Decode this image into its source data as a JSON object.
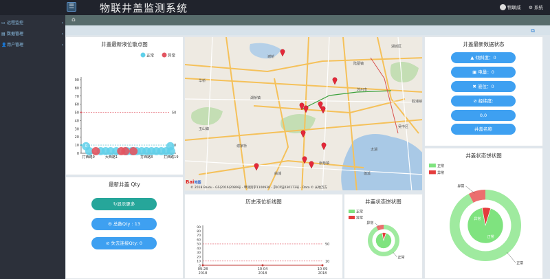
{
  "header": {
    "menu_icon": "menu-icon",
    "title": "物联井盖监测系统",
    "user_name": "物联威",
    "system_label": "系统"
  },
  "sidebar": {
    "items": [
      {
        "label": "远程监控",
        "icon": "monitor-icon"
      },
      {
        "label": "数据管理",
        "icon": "data-icon"
      },
      {
        "label": "用户管理",
        "icon": "user-icon"
      }
    ]
  },
  "scatter": {
    "title": "井盖最新液位散点图",
    "legend": [
      "正常",
      "异常"
    ],
    "colors": {
      "normal": "#5fd0ea",
      "abnormal": "#e25561",
      "markline": "#e25561",
      "markline2": "#3fb6c6"
    },
    "chart_data": {
      "type": "scatter",
      "ylim": [
        0,
        90
      ],
      "yticks": [
        0,
        10,
        20,
        30,
        40,
        50,
        60,
        70,
        80,
        90
      ],
      "xticks": [
        "打西路9",
        "大西路1",
        "打西路8",
        "打西路19"
      ],
      "marklines": [
        {
          "value": 50,
          "label": "50"
        },
        {
          "value": 10,
          "label": "10"
        }
      ],
      "normal": [
        {
          "x": 1,
          "y": 0
        },
        {
          "x": 2.4,
          "y": 0
        },
        {
          "x": 3.0,
          "y": 0
        },
        {
          "x": 3.6,
          "y": 0
        },
        {
          "x": 4.3,
          "y": 0
        },
        {
          "x": 5.6,
          "y": 0
        },
        {
          "x": 6.2,
          "y": 0
        },
        {
          "x": 6.8,
          "y": 0
        },
        {
          "x": 7.4,
          "y": 0
        },
        {
          "x": 8.0,
          "y": 0
        },
        {
          "x": 8.6,
          "y": 0
        },
        {
          "x": 9.2,
          "y": 0
        },
        {
          "x": 9.8,
          "y": 0
        },
        {
          "x": 10.4,
          "y": 0
        },
        {
          "x": 11.0,
          "y": 0
        },
        {
          "x": 0.6,
          "y": 1
        },
        {
          "x": 10.9,
          "y": 1
        }
      ],
      "abnormal": [
        {
          "x": 1.8,
          "y": 0
        },
        {
          "x": 4.9,
          "y": 0
        },
        {
          "x": 5.4,
          "y": 0
        },
        {
          "x": 6.4,
          "y": 0
        }
      ],
      "labels": [
        "0",
        "0"
      ]
    }
  },
  "map": {
    "copyright": "© 2018 Baidu - GS(2016)2089号 - 甲测资字1100930 - 京ICP证030173号 - Data © 长地万方",
    "logo": "Bai",
    "logo_suffix": "地图",
    "labels": [
      "谢桥",
      "华桥",
      "湖桥镇",
      "玉山镇",
      "谢家桥",
      "苏州市",
      "陆墓镇",
      "湖城区",
      "吴中区",
      "张巷镇",
      "曲浦",
      "莲溪",
      "胜浦镇",
      "太湖"
    ],
    "markers": 11
  },
  "status": {
    "title": "井盖最新数据状态",
    "items": [
      "倾斜度：0",
      "电量：0",
      "液位：0",
      "经纬度:",
      "0,0",
      "井盖名称"
    ]
  },
  "qty": {
    "title": "最新井盖 Qty",
    "show_more": "显示更多",
    "total": "总数Qty : 13",
    "lost": "失去连接Qty: 0"
  },
  "line": {
    "title": "历史液位折线图",
    "chart_data": {
      "type": "line",
      "ylim": [
        0,
        90
      ],
      "yticks": [
        0,
        10,
        20,
        30,
        40,
        50,
        60,
        70,
        80,
        90
      ],
      "categories": [
        "09-28\n2018",
        "10-04\n2018",
        "10-09\n2018"
      ],
      "x": [
        "09-28",
        "10-04",
        "10-09"
      ],
      "series": [
        {
          "values": [
            0,
            0,
            0
          ]
        }
      ],
      "marklines": [
        {
          "value": 50,
          "label": "50"
        },
        {
          "value": 10,
          "label": "10"
        }
      ]
    }
  },
  "pie_small": {
    "title": "井盖状态饼状图",
    "legend": [
      "正常",
      "异常"
    ],
    "chart_data": {
      "type": "pie",
      "categories": [
        "正常",
        "异常"
      ],
      "values": [
        12,
        1
      ]
    },
    "abnormal_label": "异常",
    "normal_label": "正常"
  },
  "pie_big": {
    "title": "井盖状态饼状图",
    "legend": [
      "正常",
      "异常"
    ],
    "chart_data": {
      "type": "pie",
      "categories": [
        "正常",
        "异常"
      ],
      "values": [
        12,
        1
      ]
    },
    "abnormal_label": "异常",
    "normal_label": "正常",
    "inner_abnormal": "异常",
    "inner_normal": "正常"
  },
  "colors": {
    "normal": "#7fe37f",
    "abnormal": "#e43d3d",
    "accent": "#3ea0f1",
    "teal": "#26a69a"
  }
}
